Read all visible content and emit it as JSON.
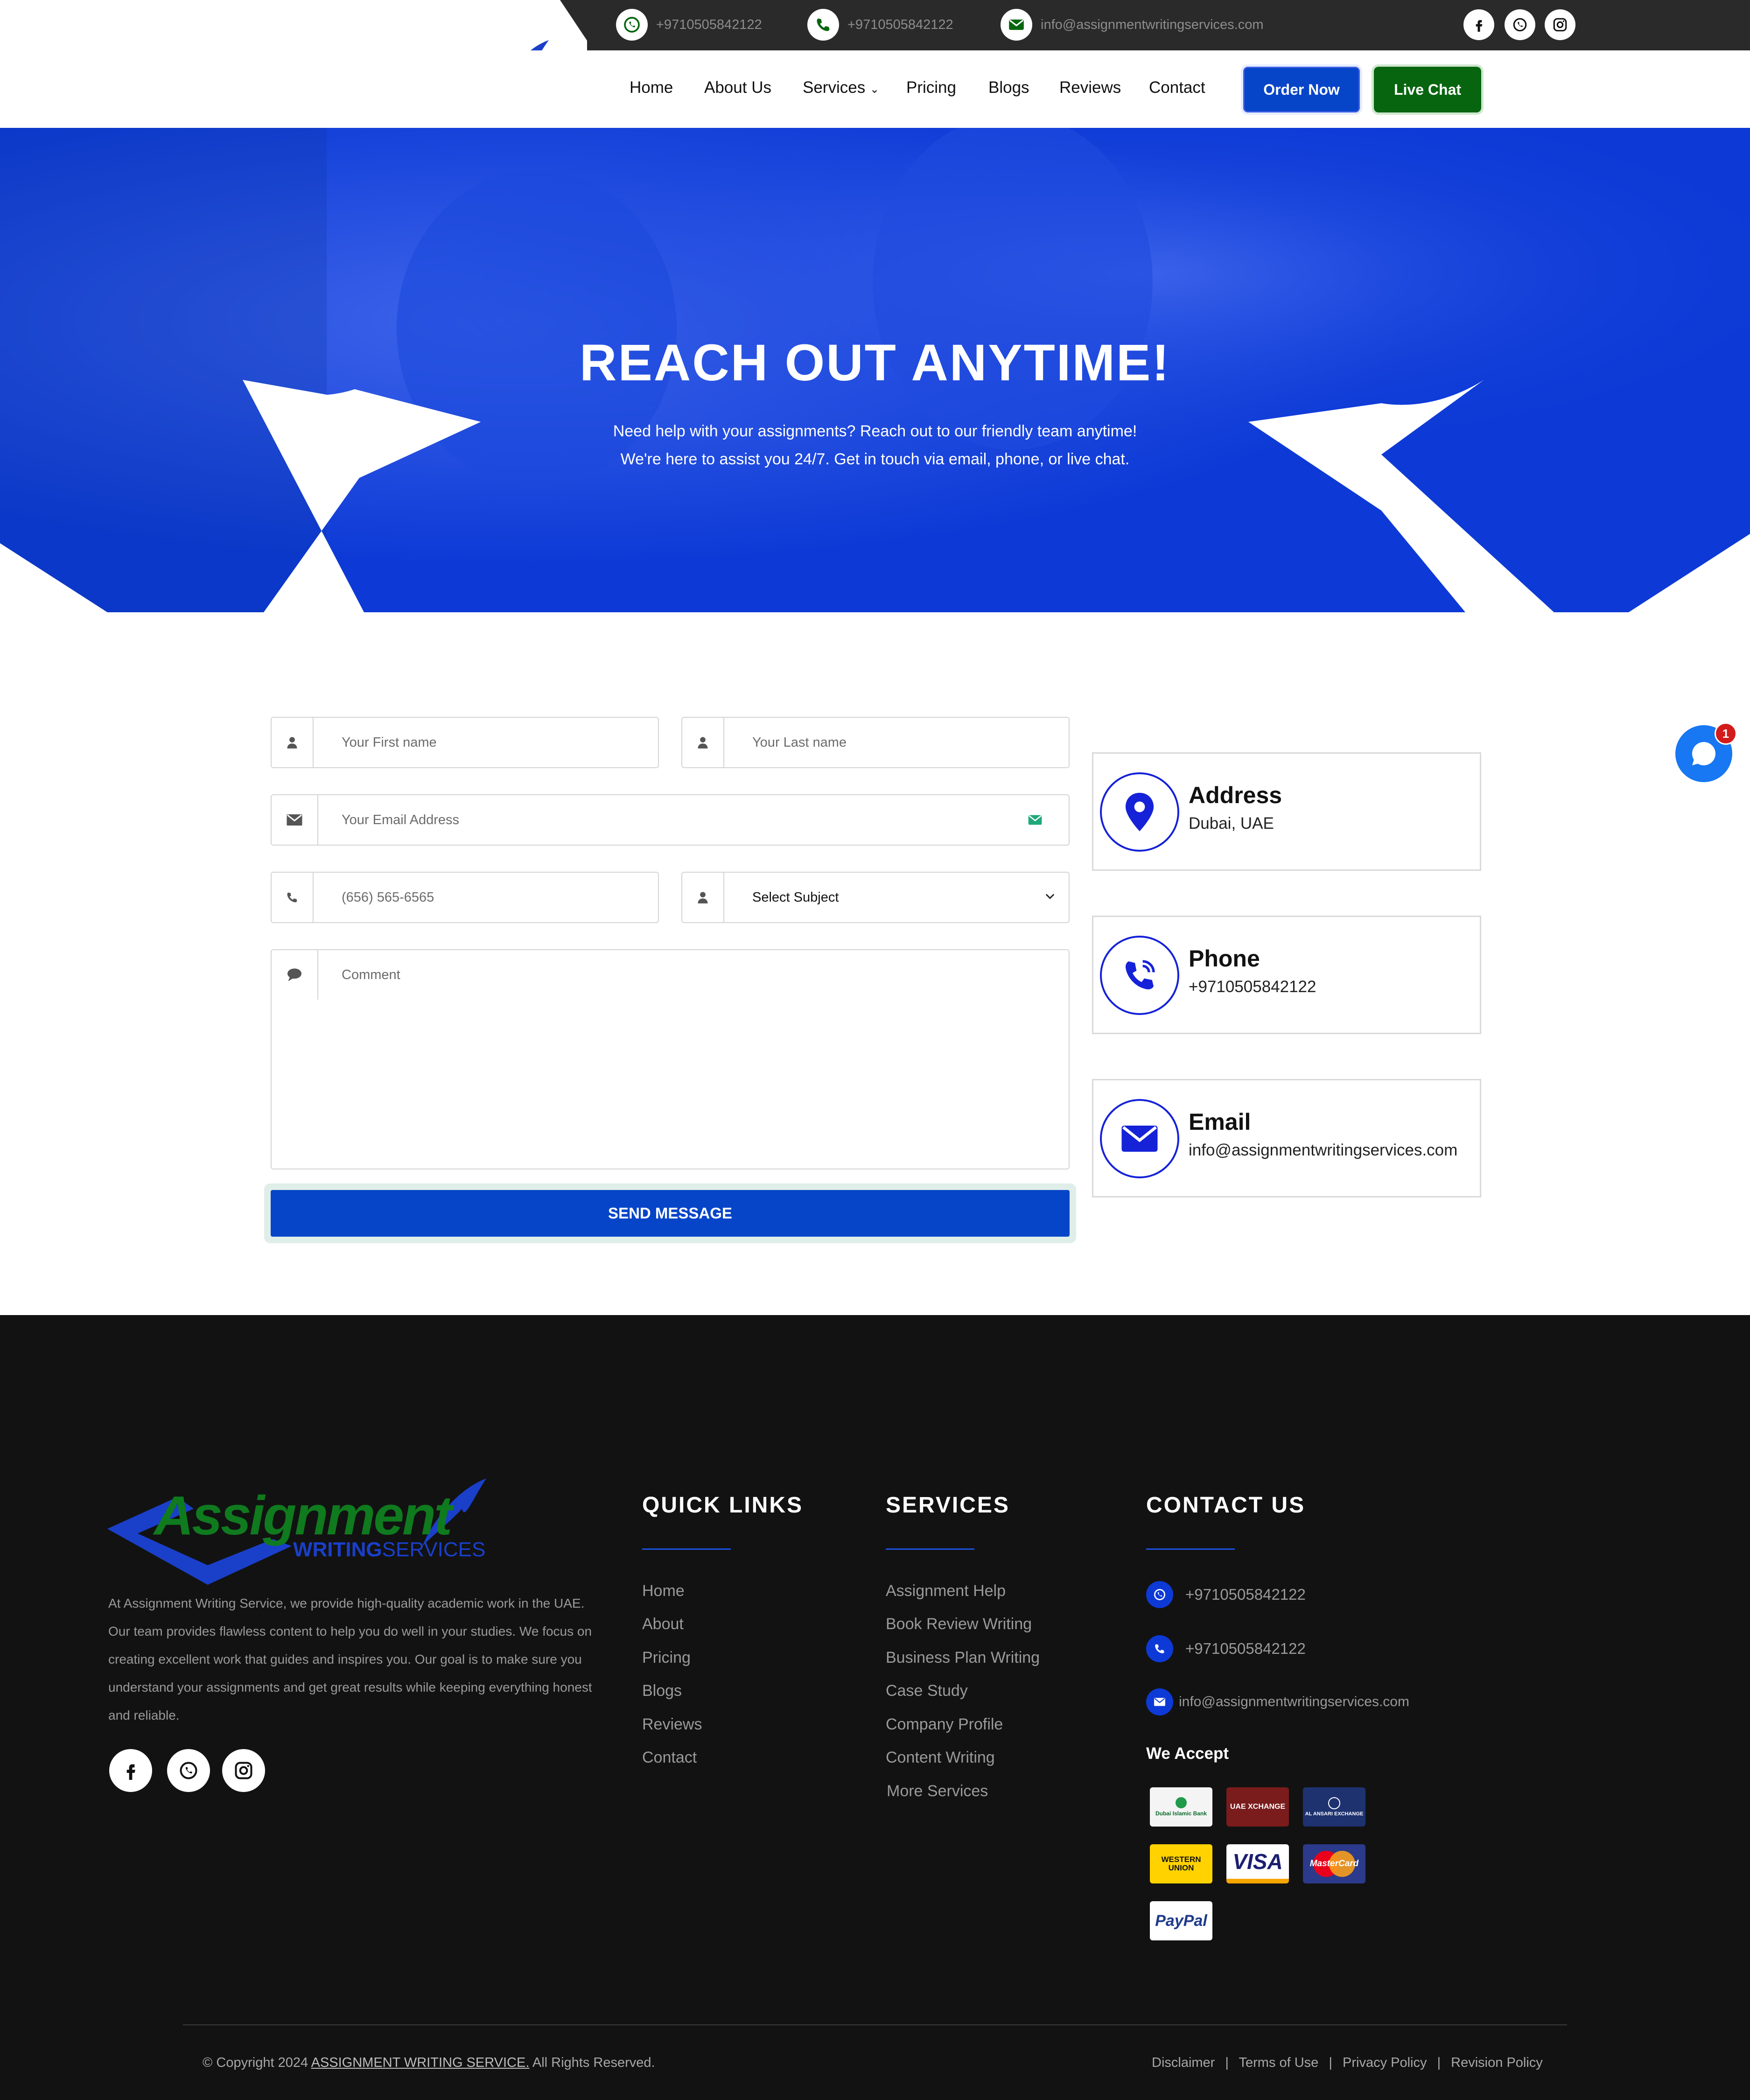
{
  "topbar": {
    "whatsapp": "+9710505842122",
    "phone": "+9710505842122",
    "email": "info@assignmentwritingservices.com"
  },
  "logo": {
    "main": "Assignment",
    "sub_bold": "WRITING",
    "sub": "SERVICES"
  },
  "nav": {
    "items": [
      "Home",
      "About Us",
      "Services",
      "Pricing",
      "Blogs",
      "Reviews",
      "Contact"
    ],
    "order_now": "Order Now",
    "live_chat": "Live Chat"
  },
  "hero": {
    "title": "REACH OUT ANYTIME!",
    "line1": "Need help with your assignments? Reach out to our friendly team anytime!",
    "line2": "We're here to assist you 24/7. Get in touch via email, phone, or live chat."
  },
  "form": {
    "first_name_placeholder": "Your First name",
    "last_name_placeholder": "Your Last name",
    "email_placeholder": "Your Email Address",
    "phone_placeholder": "(656) 565-6565",
    "subject_selected": "Select Subject",
    "comment_placeholder": "Comment",
    "send_label": "SEND MESSAGE"
  },
  "contact_cards": [
    {
      "title": "Address",
      "value": "Dubai, UAE",
      "icon": "map-pin-icon"
    },
    {
      "title": "Phone",
      "value": "+9710505842122",
      "icon": "phone-icon"
    },
    {
      "title": "Email",
      "value": "info@assignmentwritingservices.com",
      "icon": "envelope-icon"
    }
  ],
  "chat_widget": {
    "badge": "1"
  },
  "footer": {
    "about": "At Assignment Writing Service, we provide high-quality academic work in the UAE. Our team provides flawless content to help you do well in your studies. We focus on creating excellent work that guides and inspires you. Our goal is to make sure you understand your assignments and get great results while keeping everything honest and reliable.",
    "quick_links_title": "QUICK LINKS",
    "quick_links": [
      "Home",
      "About",
      "Pricing",
      "Blogs",
      "Reviews",
      "Contact"
    ],
    "services_title": "SERVICES",
    "services": [
      "Assignment Help",
      "Book Review Writing",
      "Business Plan Writing",
      "Case Study",
      "Company Profile",
      "Content Writing",
      "More Services"
    ],
    "contact_title": "CONTACT US",
    "contact_whatsapp": "+9710505842122",
    "contact_phone": "+9710505842122",
    "contact_email": "info@assignmentwritingservices.com",
    "we_accept": "We Accept",
    "payments": [
      "Dubai Islamic Bank",
      "UAE XCHANGE",
      "AL ANSARI EXCHANGE",
      "WESTERN UNION",
      "VISA",
      "MasterCard",
      "PayPal"
    ],
    "copyright_pre": "© Copyright 2024",
    "copyright_link": "ASSIGNMENT WRITING SERVICE.",
    "copyright_post": "All Rights Reserved.",
    "legal": [
      "Disclaimer",
      "Terms of Use",
      "Privacy Policy",
      "Revision Policy"
    ]
  },
  "colors": {
    "brand_blue": "#0645c8",
    "brand_green": "#07650f",
    "hero_blue": "#0d3ad6",
    "footer_bg": "#121212"
  }
}
